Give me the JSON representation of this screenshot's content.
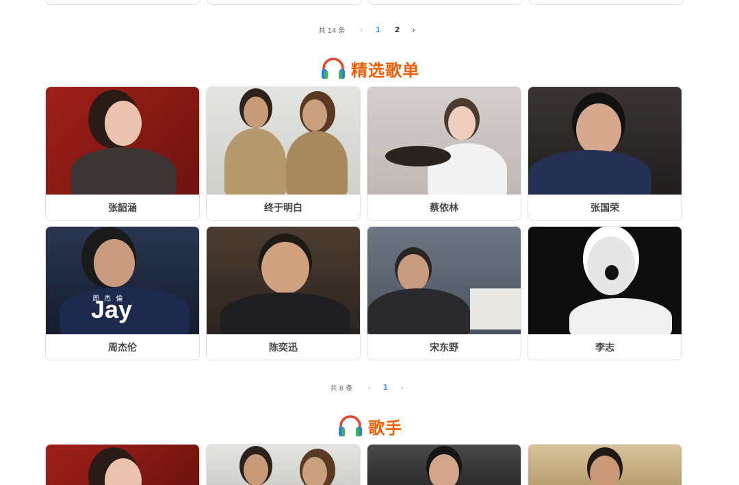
{
  "pager_top": {
    "total": "共 14 条",
    "prev": "‹",
    "pages": [
      "1",
      "2"
    ],
    "current": "1",
    "next": "›"
  },
  "playlists": {
    "title": "精选歌单",
    "icon": "headphones-icon",
    "cards": [
      {
        "name": "张韶涵",
        "bg": "#8c1c17"
      },
      {
        "name": "终于明白",
        "bg": "#d9d9d6"
      },
      {
        "name": "蔡依林",
        "bg": "#cfcac8"
      },
      {
        "name": "张国荣",
        "bg": "#2d2a2a"
      },
      {
        "name": "周杰伦",
        "bg": "#182238",
        "overlay": "Jay",
        "overlay_small": "周 杰 倫"
      },
      {
        "name": "陈奕迅",
        "bg": "#3a2e26"
      },
      {
        "name": "宋东野",
        "bg": "#5b6573"
      },
      {
        "name": "李志",
        "bg": "#0d0d0d"
      }
    ]
  },
  "pager_mid": {
    "total": "共 8 条",
    "prev": "‹",
    "pages": [
      "1"
    ],
    "current": "1",
    "next": "›"
  },
  "singers": {
    "title": "歌手",
    "icon": "headphones-icon",
    "cards": [
      {
        "bg": "#8c1c17"
      },
      {
        "bg": "#d9d9d6"
      },
      {
        "bg": "#3b3b3b"
      },
      {
        "bg": "#c9b38b"
      }
    ]
  },
  "colors": {
    "accent": "#f25c05",
    "page_active": "#409eff"
  }
}
